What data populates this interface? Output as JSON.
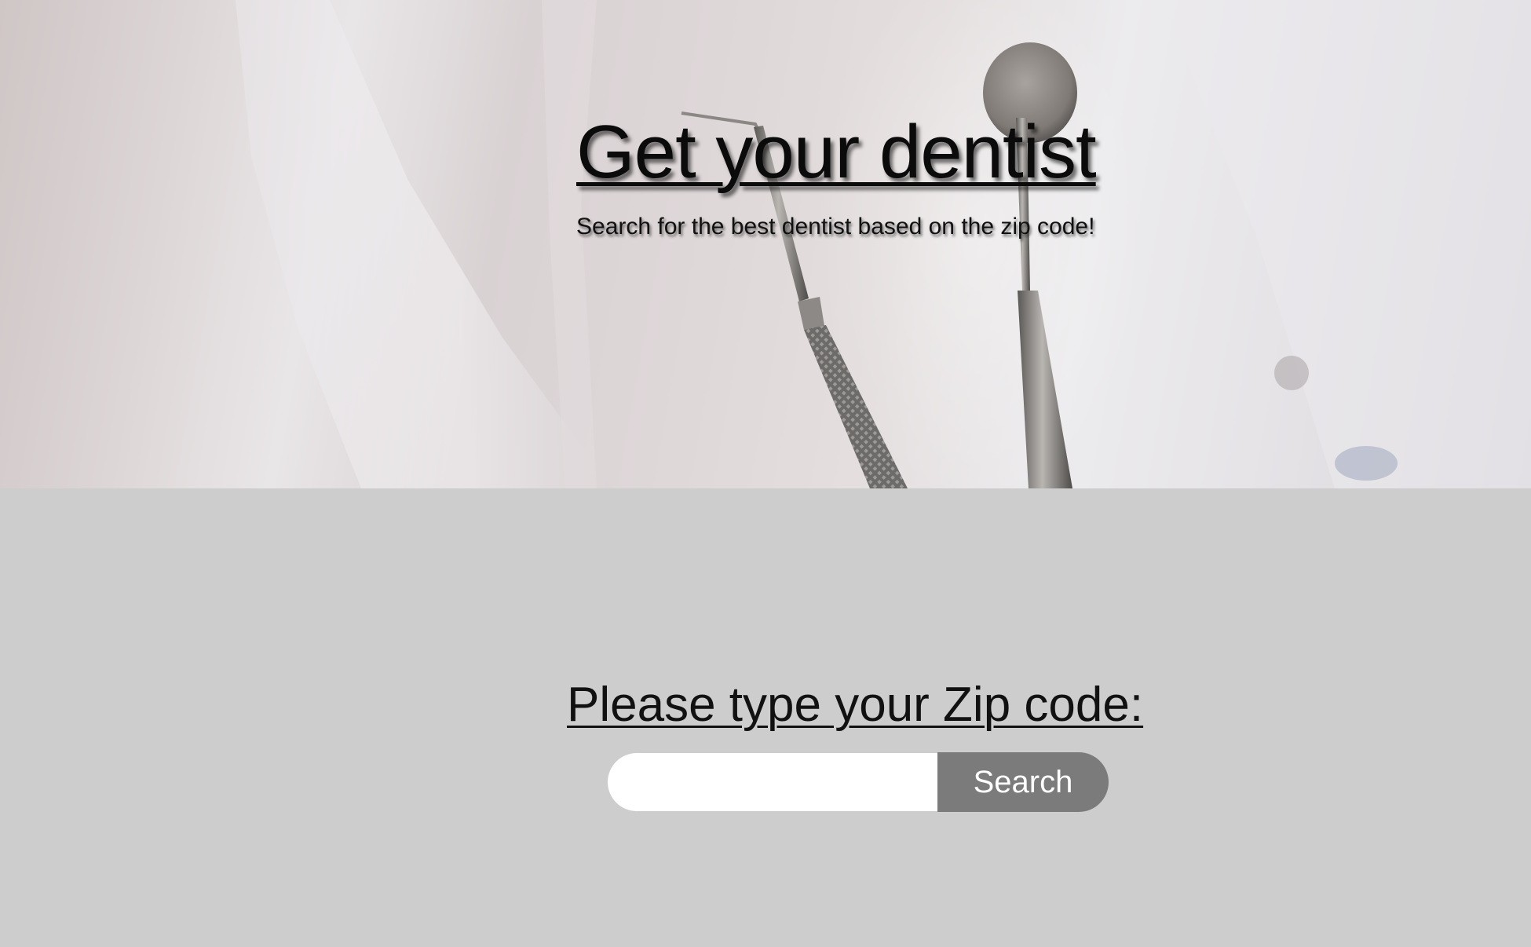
{
  "hero": {
    "title": "Get your dentist",
    "subtitle": "Search for the best dentist based on the zip code!"
  },
  "search": {
    "label": "Please type your Zip code:",
    "input_value": "",
    "placeholder": "",
    "button_label": "Search"
  },
  "colors": {
    "section_background": "#cdcdcd",
    "button_background": "#7b7b7b",
    "button_text": "#ffffff",
    "input_background": "#ffffff"
  }
}
